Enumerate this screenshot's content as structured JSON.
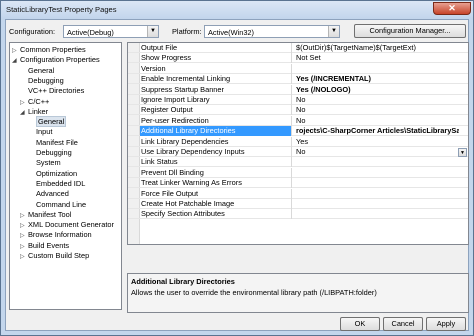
{
  "window": {
    "title": "StaticLibraryTest Property Pages",
    "close_label": "✕"
  },
  "toolbar": {
    "configuration_label": "Configuration:",
    "configuration_value": "Active(Debug)",
    "platform_label": "Platform:",
    "platform_value": "Active(Win32)",
    "config_manager_label": "Configuration Manager..."
  },
  "tree": {
    "items": [
      {
        "label": "Common Properties",
        "glyph": "▷"
      },
      {
        "label": "Configuration Properties",
        "glyph": "◢"
      },
      {
        "label": "General",
        "glyph": ""
      },
      {
        "label": "Debugging",
        "glyph": ""
      },
      {
        "label": "VC++ Directories",
        "glyph": ""
      },
      {
        "label": "C/C++",
        "glyph": "▷"
      },
      {
        "label": "Linker",
        "glyph": "◢"
      },
      {
        "label": "General",
        "glyph": ""
      },
      {
        "label": "Input",
        "glyph": ""
      },
      {
        "label": "Manifest File",
        "glyph": ""
      },
      {
        "label": "Debugging",
        "glyph": ""
      },
      {
        "label": "System",
        "glyph": ""
      },
      {
        "label": "Optimization",
        "glyph": ""
      },
      {
        "label": "Embedded IDL",
        "glyph": ""
      },
      {
        "label": "Advanced",
        "glyph": ""
      },
      {
        "label": "Command Line",
        "glyph": ""
      },
      {
        "label": "Manifest Tool",
        "glyph": "▷"
      },
      {
        "label": "XML Document Generator",
        "glyph": "▷"
      },
      {
        "label": "Browse Information",
        "glyph": "▷"
      },
      {
        "label": "Build Events",
        "glyph": "▷"
      },
      {
        "label": "Custom Build Step",
        "glyph": "▷"
      }
    ]
  },
  "grid": {
    "rows": [
      {
        "name": "Output File",
        "value": "$(OutDir)$(TargetName)$(TargetExt)"
      },
      {
        "name": "Show Progress",
        "value": "Not Set"
      },
      {
        "name": "Version",
        "value": ""
      },
      {
        "name": "Enable Incremental Linking",
        "value": "Yes (/INCREMENTAL)"
      },
      {
        "name": "Suppress Startup Banner",
        "value": "Yes (/NOLOGO)"
      },
      {
        "name": "Ignore Import Library",
        "value": "No"
      },
      {
        "name": "Register Output",
        "value": "No"
      },
      {
        "name": "Per-user Redirection",
        "value": "No"
      },
      {
        "name": "Additional Library Directories",
        "value": "rojects\\C-SharpCorner Articles\\StaticLibrarySample\\D"
      },
      {
        "name": "Link Library Dependencies",
        "value": "Yes"
      },
      {
        "name": "Use Library Dependency Inputs",
        "value": "No"
      },
      {
        "name": "Link Status",
        "value": ""
      },
      {
        "name": "Prevent Dll Binding",
        "value": ""
      },
      {
        "name": "Treat Linker Warning As Errors",
        "value": ""
      },
      {
        "name": "Force File Output",
        "value": ""
      },
      {
        "name": "Create Hot Patchable Image",
        "value": ""
      },
      {
        "name": "Specify Section Attributes",
        "value": ""
      }
    ],
    "dropdown_glyph": "▼"
  },
  "description": {
    "title": "Additional Library Directories",
    "text": "Allows the user to override the environmental library path (/LIBPATH:folder)"
  },
  "footer": {
    "ok_label": "OK",
    "cancel_label": "Cancel",
    "apply_label": "Apply"
  }
}
